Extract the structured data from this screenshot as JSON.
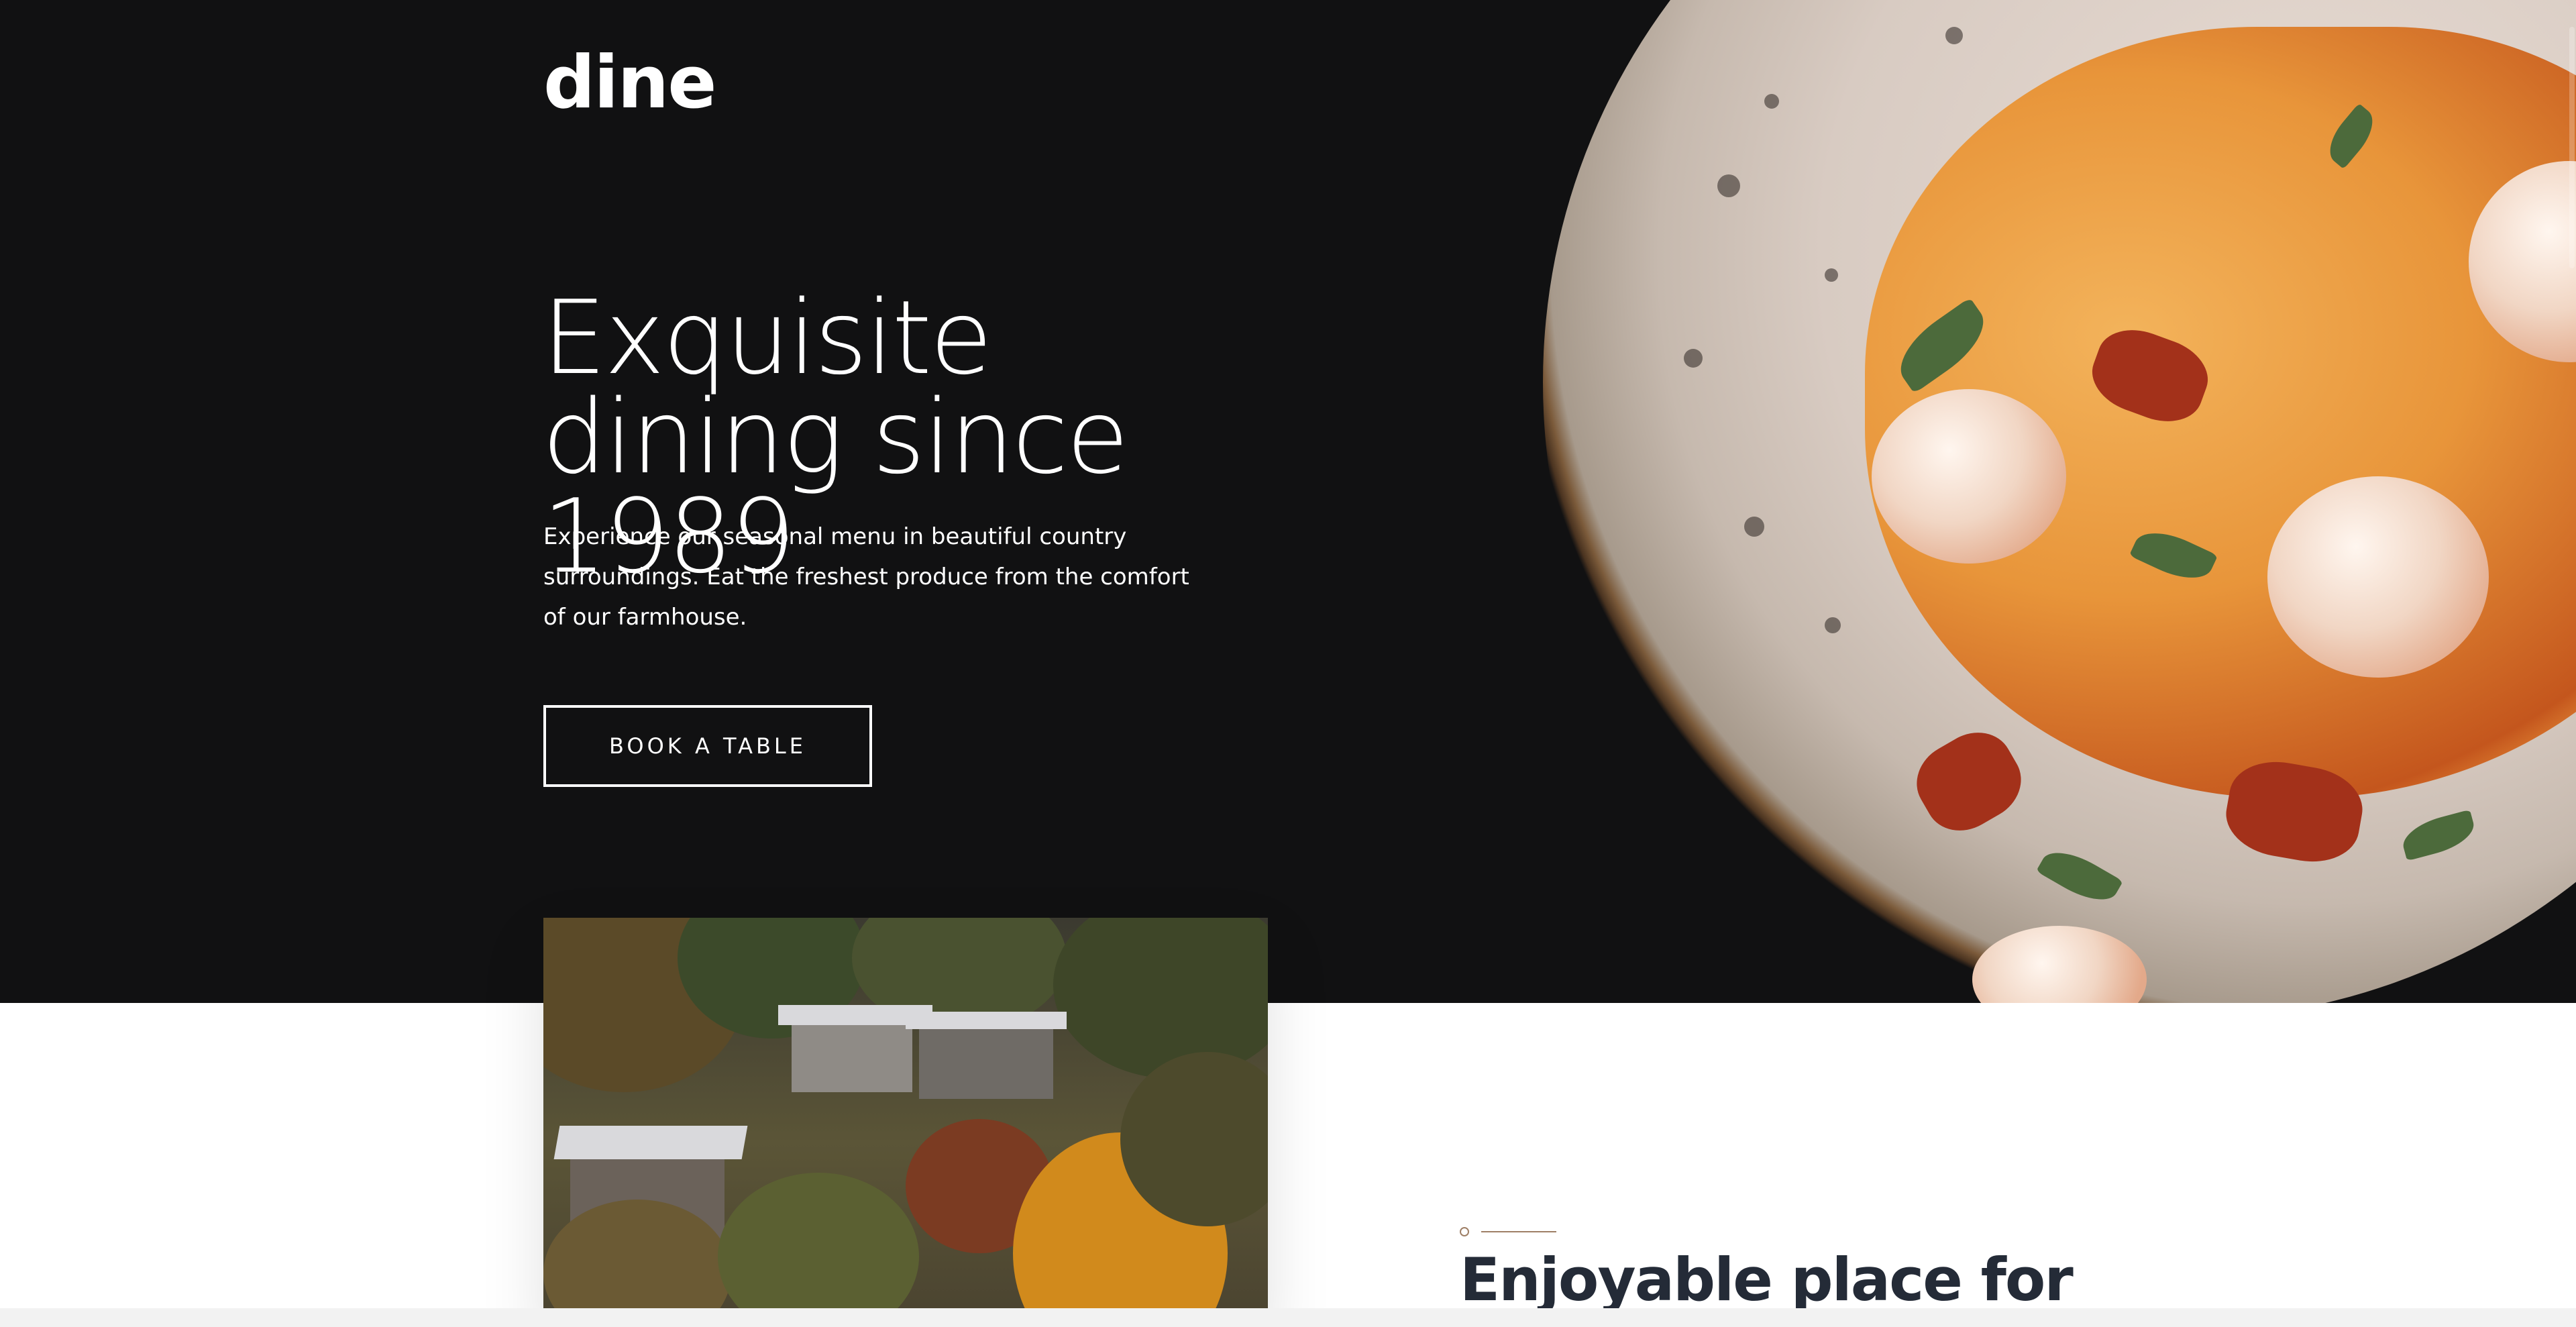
{
  "brand": {
    "logo_text": "dine"
  },
  "hero": {
    "headline": "Exquisite dining since 1989",
    "intro": "Experience our seasonal menu in beautiful country surroundings. Eat the freshest produce from the comfort of our farmhouse.",
    "cta_label": "BOOK A TABLE",
    "image": "pasta-plate-photo"
  },
  "about": {
    "image": "village-photo",
    "title": "Enjoyable place for"
  },
  "colors": {
    "hero_bg": "#111112",
    "text_light": "#ffffff",
    "accent": "#9e7f66",
    "title_dark": "#242b37"
  }
}
